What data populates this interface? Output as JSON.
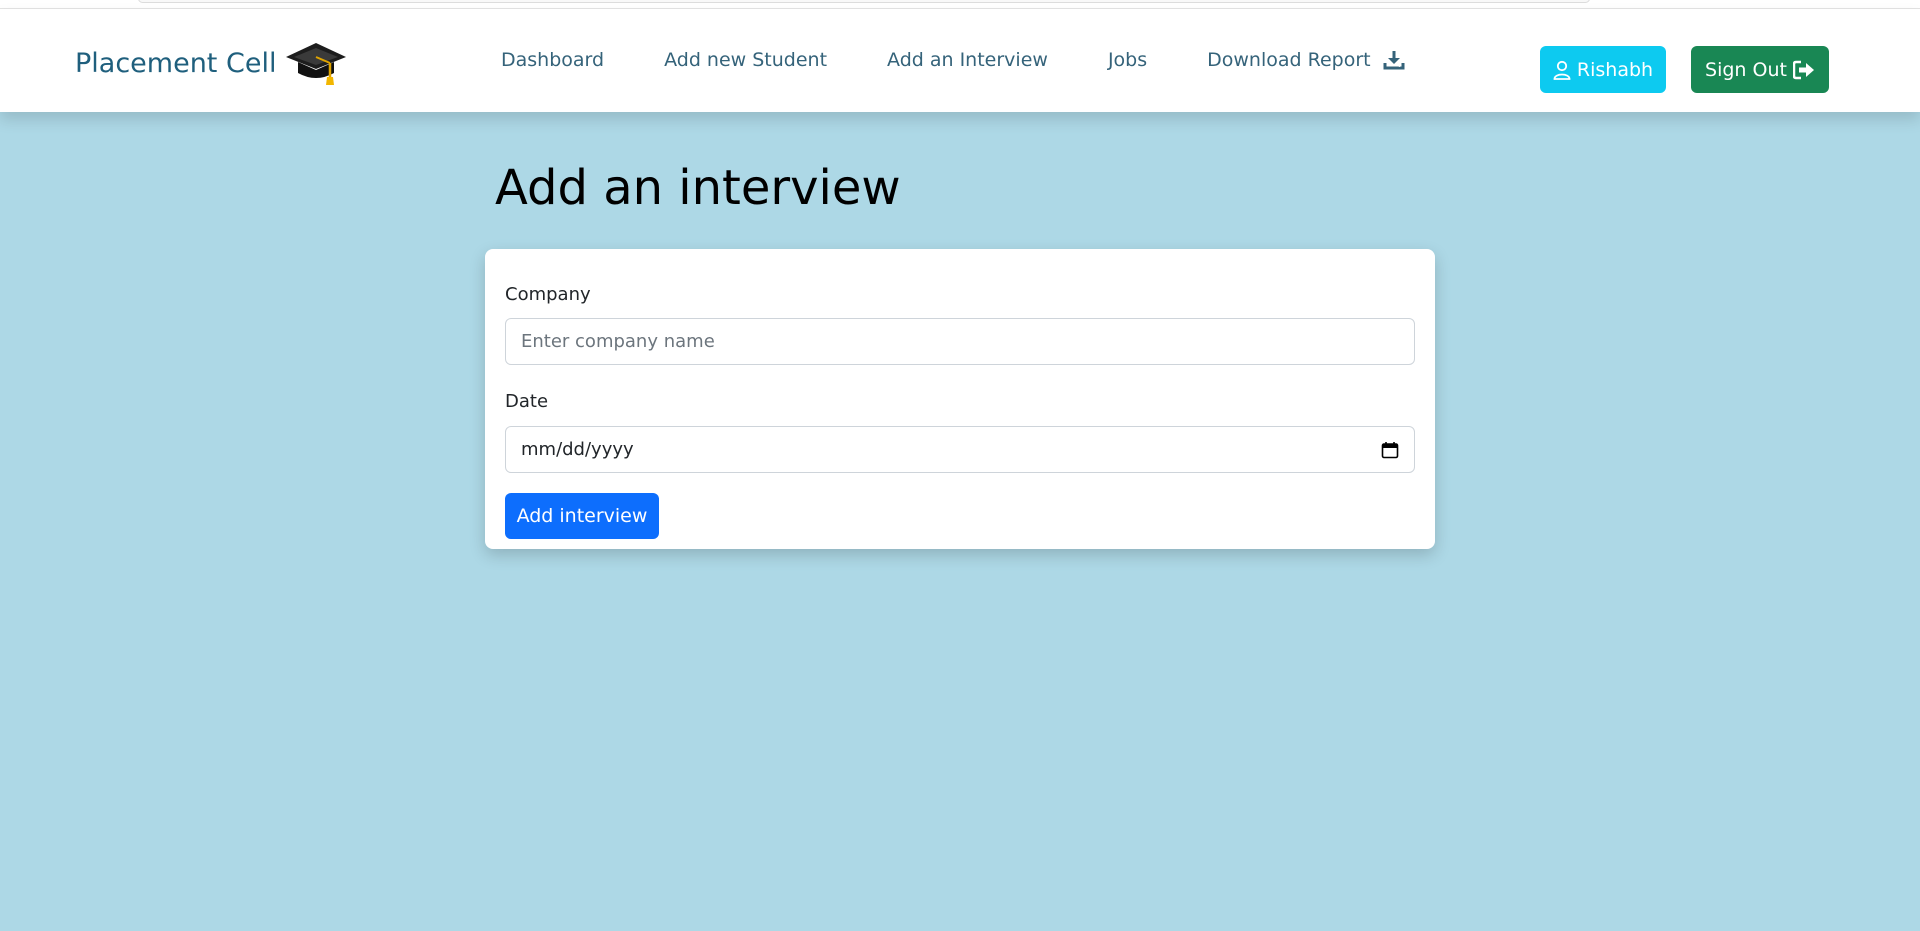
{
  "brand": {
    "title": "Placement Cell",
    "icon": "graduation-cap-icon"
  },
  "nav": {
    "items": [
      {
        "label": "Dashboard"
      },
      {
        "label": "Add new Student"
      },
      {
        "label": "Add an Interview"
      },
      {
        "label": "Jobs"
      },
      {
        "label": "Download Report",
        "icon": "download-icon"
      }
    ]
  },
  "user": {
    "name": "Rishabh",
    "icon": "user-icon",
    "color": "#0dcaf0"
  },
  "signout": {
    "label": "Sign Out",
    "icon": "sign-out-icon",
    "color": "#198754"
  },
  "page": {
    "title": "Add an interview"
  },
  "form": {
    "company": {
      "label": "Company",
      "placeholder": "Enter company name",
      "value": ""
    },
    "date": {
      "label": "Date",
      "placeholder": "mm/dd/yyyy",
      "icon": "calendar-icon"
    },
    "submit_label": "Add interview"
  },
  "colors": {
    "background": "#add8e6",
    "primary": "#0d6efd",
    "brand": "#1f5f7d"
  }
}
